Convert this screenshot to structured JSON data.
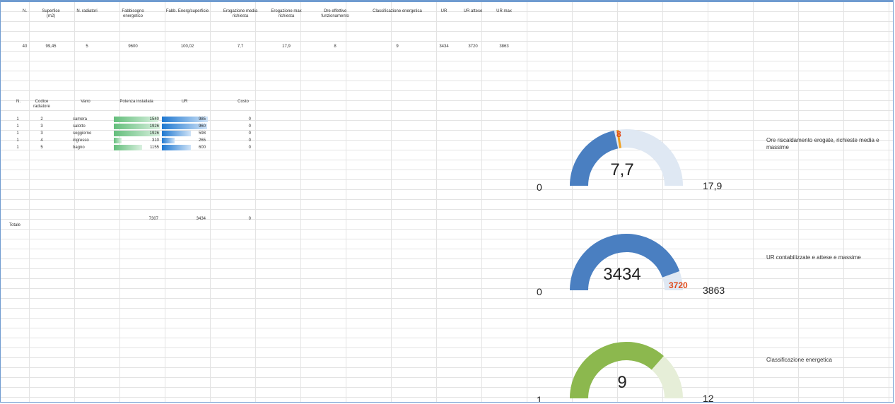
{
  "header": {
    "columns": [
      "N.",
      "Superfice (m2)",
      "N. radiatori",
      "Fabbisogno energetico",
      "Fabb. Energ/superficie",
      "Erogazione media richiesta",
      "Erogazione max richiesta",
      "Ore effettive funzionamento",
      "Classificazione energetica",
      "UR",
      "UR attese",
      "UR max"
    ],
    "values": [
      "40",
      "99,45",
      "5",
      "9600",
      "100,02",
      "7,7",
      "17,9",
      "8",
      "9",
      "3434",
      "3720",
      "3863"
    ]
  },
  "radiators": {
    "columns": [
      "N.",
      "Codice radiatore",
      "Vano",
      "Potenza installata",
      "UR",
      "Costo"
    ],
    "rows": [
      {
        "n": "1",
        "code": "2",
        "room": "camera",
        "power": "1540",
        "ur": "985",
        "cost": "0",
        "power_frac": 0.96,
        "ur_frac": 0.98
      },
      {
        "n": "1",
        "code": "3",
        "room": "salotto",
        "power": "1926",
        "ur": "960",
        "cost": "0",
        "power_frac": 0.99,
        "ur_frac": 0.97
      },
      {
        "n": "1",
        "code": "3",
        "room": "soggiorno",
        "power": "1926",
        "ur": "598",
        "cost": "0",
        "power_frac": 0.99,
        "ur_frac": 0.62
      },
      {
        "n": "1",
        "code": "4",
        "room": "ingresso",
        "power": "310",
        "ur": "265",
        "cost": "0",
        "power_frac": 0.16,
        "ur_frac": 0.27
      },
      {
        "n": "1",
        "code": "5",
        "room": "bagno",
        "power": "1155",
        "ur": "600",
        "cost": "0",
        "power_frac": 0.6,
        "ur_frac": 0.62
      }
    ],
    "total_label": "Totale",
    "total_power": "7307",
    "total_ur": "3434",
    "total_cost": "0"
  },
  "gauges": [
    {
      "min": "0",
      "max": "17,9",
      "value": "7,7",
      "marker": "8",
      "fraction": 0.43,
      "marker_fraction": 0.45,
      "color": "#4a7fc1",
      "track": "#dfe8f3",
      "caption": "Ore riscaldamento erogate, richieste media e massime"
    },
    {
      "min": "0",
      "max": "3863",
      "value": "3434",
      "marker": "3720",
      "fraction": 0.89,
      "marker_fraction": 0.96,
      "color": "#4a7fc1",
      "track": "#dfe8f3",
      "caption": "UR contabilizzate e attese e massime"
    },
    {
      "min": "1",
      "max": "12",
      "value": "9",
      "marker": "",
      "fraction": 0.73,
      "marker_fraction": 0,
      "color": "#8cb84e",
      "track": "#e6eed8",
      "caption": "Classificazione energetica"
    }
  ]
}
